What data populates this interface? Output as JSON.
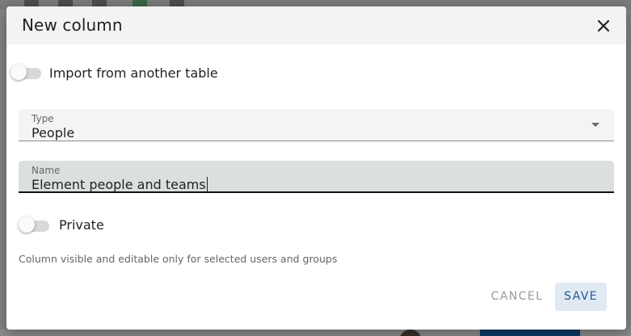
{
  "dialog": {
    "title": "New column",
    "close_icon": "close-icon"
  },
  "import_toggle": {
    "label": "Import from another table",
    "checked": false
  },
  "type_field": {
    "label": "Type",
    "value": "People"
  },
  "name_field": {
    "label": "Name",
    "value": "Element people and teams"
  },
  "private_toggle": {
    "label": "Private",
    "checked": false
  },
  "helper_text": "Column visible and editable only for selected users and groups",
  "actions": {
    "cancel_label": "CANCEL",
    "save_label": "SAVE"
  },
  "colors": {
    "accent": "#1f5a96",
    "save_bg": "#e1e9f3",
    "header_bg": "#f3f3f3",
    "field_active_bg": "#dcdfe0"
  }
}
